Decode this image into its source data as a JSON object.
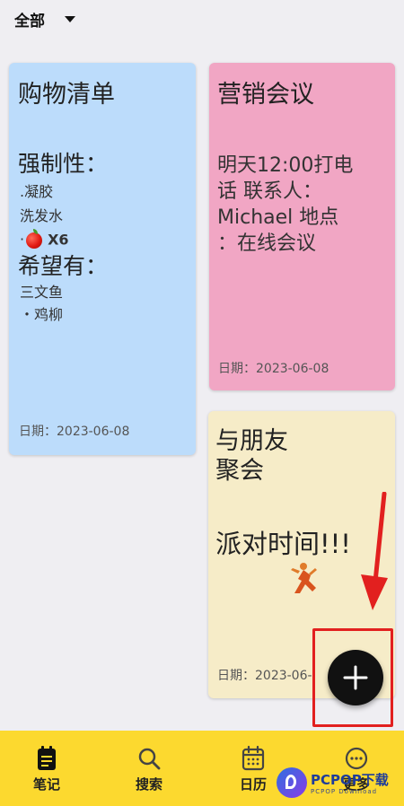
{
  "filter": {
    "label": "全部"
  },
  "notes": [
    {
      "title": "购物清单",
      "section1": "强制性：",
      "items1": [
        ".凝胶",
        "洗发水"
      ],
      "apple_item": {
        "prefix": "·",
        "qty": "X6"
      },
      "section2": "希望有：",
      "items2": [
        "三文鱼",
        "・鸡柳"
      ],
      "date": "日期：2023-06-08",
      "color": "#bcdcfb"
    },
    {
      "title": "营销会议",
      "body": [
        "明天12:00打电",
        "话 联系人：",
        "Michael 地点",
        "：在线会议"
      ],
      "date": "日期：2023-06-08",
      "color": "#f1a6c4"
    },
    {
      "title_lines": [
        "与朋友",
        "聚会"
      ],
      "party": "派对时间!!!",
      "date": "日期：2023-06-",
      "color": "#f6ecc8"
    }
  ],
  "fab": {
    "icon": "plus-icon"
  },
  "nav": {
    "notes": "笔记",
    "search": "搜索",
    "calendar": "日历",
    "more": "更多"
  },
  "watermark": {
    "text": "PCPOP下载",
    "sub": "PCPOP Download"
  },
  "colors": {
    "accent": "#fcd92f",
    "highlight": "#e2201f",
    "fab": "#111111"
  }
}
